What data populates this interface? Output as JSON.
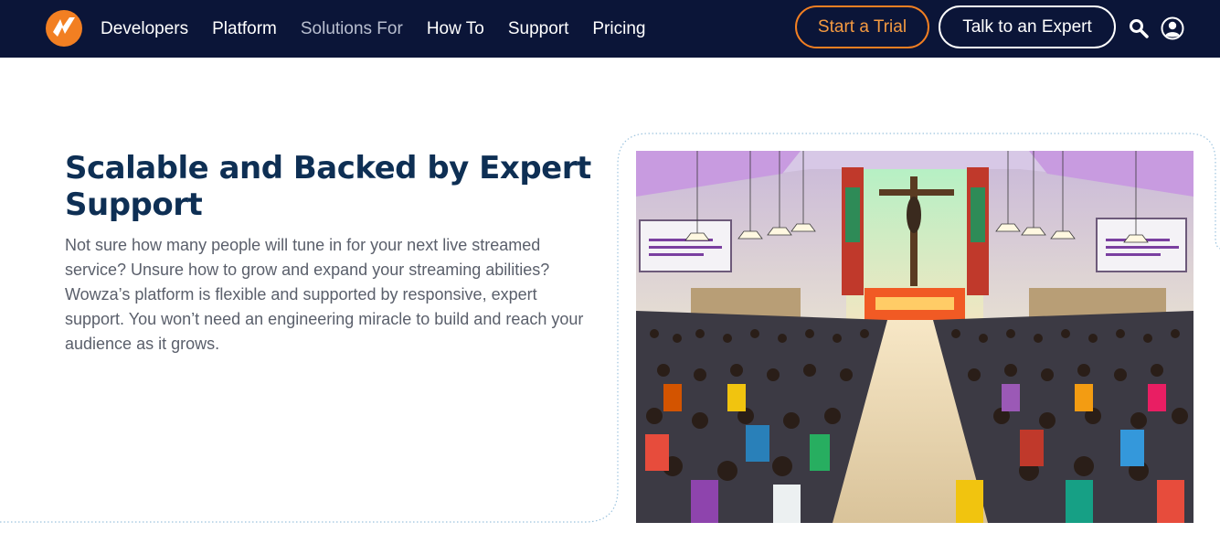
{
  "nav": {
    "brand_color": "#f27f22",
    "background": "#0b1538",
    "links": [
      {
        "label": "Developers"
      },
      {
        "label": "Platform"
      },
      {
        "label": "Solutions For"
      },
      {
        "label": "How To"
      },
      {
        "label": "Support"
      },
      {
        "label": "Pricing"
      }
    ],
    "trial_label": "Start a Trial",
    "expert_label": "Talk to an Expert",
    "icons": [
      "wowza-logo-icon",
      "search-icon",
      "user-account-icon"
    ]
  },
  "hero": {
    "title": "Scalable and Backed by Expert Support",
    "body": "Not sure how many people will tune in for your next live streamed service? Unsure how to grow and expand your streaming abilities? Wowza’s platform is flexible and supported by responsive, expert support. You won’t need an engineering miracle to build and reach your audience as it grows.",
    "title_color": "#0e2f54",
    "image_subject": "church-congregation-photo"
  }
}
